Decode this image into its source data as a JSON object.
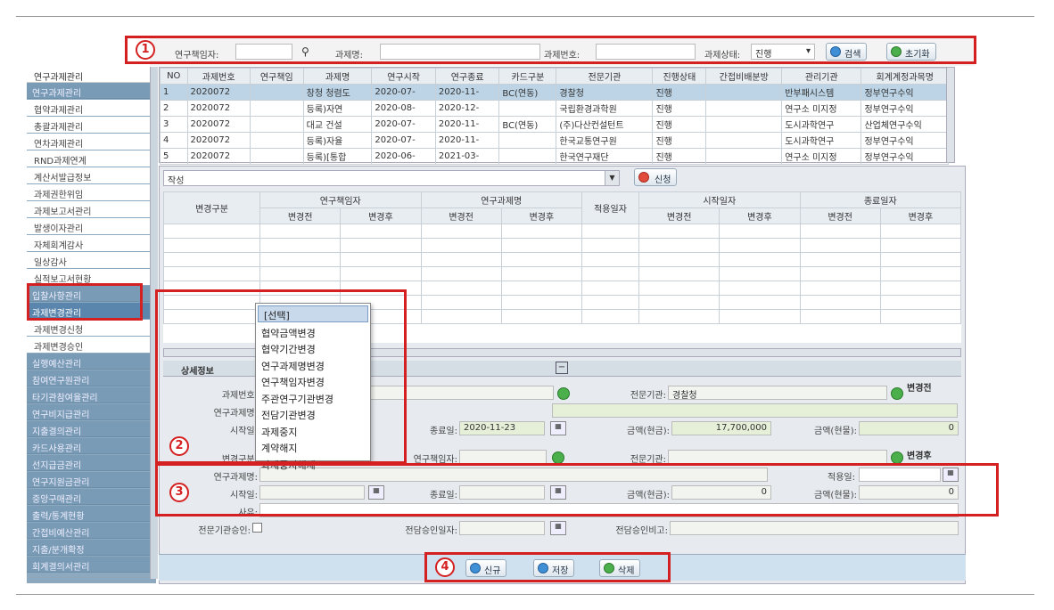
{
  "search": {
    "researcher_label": "연구책임자:",
    "title_label": "과제명:",
    "number_label": "과제번호:",
    "status_label": "과제상태:",
    "status_value": "진행",
    "search_button": "검색",
    "reset_button": "초기화"
  },
  "sidebar": {
    "header": "연구과제관리",
    "items": [
      {
        "label": "연구과제관리",
        "type": "sec"
      },
      {
        "label": "협약과제관리",
        "type": "sub"
      },
      {
        "label": "총괄과제관리",
        "type": "sub"
      },
      {
        "label": "연차과제관리",
        "type": "sub"
      },
      {
        "label": "RND과제연계",
        "type": "sub"
      },
      {
        "label": "계산서발급정보",
        "type": "sub"
      },
      {
        "label": "과제권한위임",
        "type": "sub"
      },
      {
        "label": "과제보고서관리",
        "type": "sub"
      },
      {
        "label": "발생이자관리",
        "type": "sub"
      },
      {
        "label": "자체회계감사",
        "type": "sub"
      },
      {
        "label": "일상감사",
        "type": "sub"
      },
      {
        "label": "실적보고서현황",
        "type": "sub"
      },
      {
        "label": "입찰사항관리",
        "type": "sec"
      },
      {
        "label": "과제변경관리",
        "type": "hl"
      },
      {
        "label": "과제변경신청",
        "type": "sub"
      },
      {
        "label": "과제변경승인",
        "type": "sub"
      },
      {
        "label": "실행예산관리",
        "type": "sec"
      },
      {
        "label": "참여연구원관리",
        "type": "sec"
      },
      {
        "label": "타기관참여율관리",
        "type": "sec"
      },
      {
        "label": "연구비지급관리",
        "type": "sec"
      },
      {
        "label": "지출결의관리",
        "type": "sec"
      },
      {
        "label": "카드사용관리",
        "type": "sec"
      },
      {
        "label": "선지급금관리",
        "type": "sec"
      },
      {
        "label": "연구지원금관리",
        "type": "sec"
      },
      {
        "label": "중앙구매관리",
        "type": "sec"
      },
      {
        "label": "출력/통계현황",
        "type": "sec"
      },
      {
        "label": "간접비예산관리",
        "type": "sec"
      },
      {
        "label": "지출/분개확정",
        "type": "sec"
      },
      {
        "label": "회계결의서관리",
        "type": "sec"
      }
    ]
  },
  "grid": {
    "headers": [
      "NO",
      "과제번호",
      "연구책임",
      "과제명",
      "연구시작",
      "연구종료",
      "카드구분",
      "전문기관",
      "진행상태",
      "간접비배분방",
      "관리기관",
      "회계계정과목명"
    ],
    "rows": [
      [
        "1",
        "2020072",
        "",
        "창청 청렴도",
        "2020-07-",
        "2020-11-",
        "BC(연동)",
        "경찰청",
        "진행",
        "",
        "반부패시스템",
        "정부연구수익"
      ],
      [
        "2",
        "2020072",
        "",
        "등록)자연",
        "2020-08-",
        "2020-12-",
        "",
        "국립환경과학원",
        "진행",
        "",
        "연구소 미지정",
        "정부연구수익"
      ],
      [
        "3",
        "2020072",
        "",
        "대교 건설",
        "2020-07-",
        "2020-11-",
        "BC(연동)",
        "(주)다산컨설턴트",
        "진행",
        "",
        "도시과학연구",
        "산업체연구수익"
      ],
      [
        "4",
        "2020072",
        "",
        "등록)자율",
        "2020-07-",
        "2020-11-",
        "",
        "한국교통연구원",
        "진행",
        "",
        "도시과학연구",
        "정부연구수익"
      ],
      [
        "5",
        "2020072",
        "",
        "등록)[통합",
        "2020-06-",
        "2021-03-",
        "",
        "한국연구재단",
        "진행",
        "",
        "연구소 미지정",
        "정부연구수익"
      ]
    ]
  },
  "change": {
    "dropdown_value": "작성",
    "apply_button": "신청",
    "col_type": "변경구분",
    "col_researcher": "연구책임자",
    "col_title": "연구과제명",
    "col_apply_date": "적용일자",
    "col_start": "시작일자",
    "col_end": "종료일자",
    "before": "변경전",
    "after": "변경후"
  },
  "popup": {
    "options": [
      "[선택]",
      "협약금액변경",
      "협약기간변경",
      "연구과제명변경",
      "연구책임자변경",
      "주관연구기관변경",
      "전담기관변경",
      "과제중지",
      "계약해지",
      "과제중지해제"
    ]
  },
  "detail": {
    "title": "상세정보",
    "before_tag": "변경전",
    "after_tag": "변경후",
    "task_no_label": "과제번호:",
    "task_name_label": "연구과제명:",
    "start_label": "시작일:",
    "end_label": "종료일:",
    "end_value": "2020-11-23",
    "amount_cash_label": "금액(현금):",
    "amount_cash_value": "17,700,000",
    "amount_goods_label": "금액(현물):",
    "amount_goods_value": "0",
    "agency_label": "전문기관:",
    "agency_value": "경찰청",
    "change_type_label": "변경구분:",
    "researcher_label": "연구책임자:",
    "apply_date_label": "적용일:",
    "reason_label": "사유:",
    "after_cash_value": "0",
    "after_goods_value": "0",
    "agency_approve_label": "전문기관승인:",
    "charge_date_label": "전담승인일자:",
    "charge_note_label": "전담승인비고:"
  },
  "bottom": {
    "new_button": "신규",
    "save_button": "저장",
    "delete_button": "삭제"
  },
  "markers": [
    "1",
    "2",
    "3",
    "4"
  ]
}
